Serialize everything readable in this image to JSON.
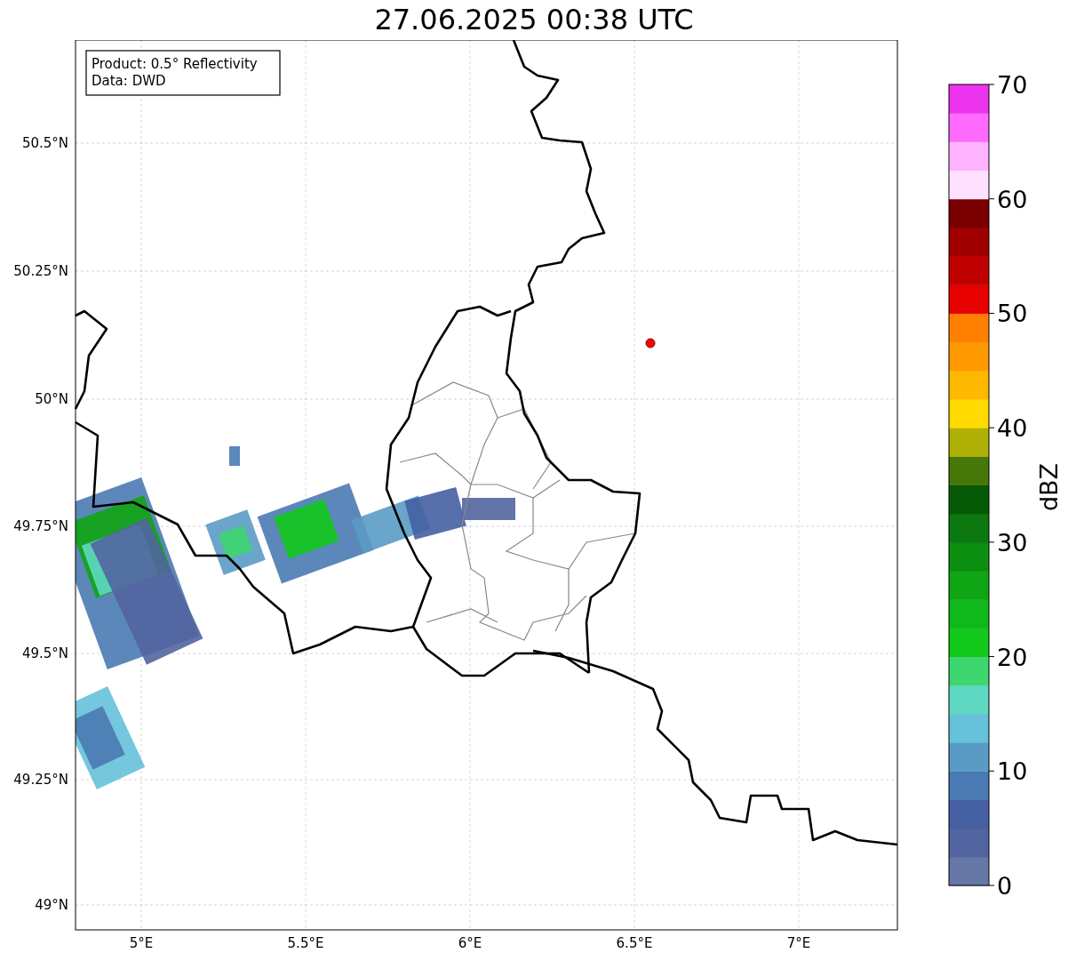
{
  "title": "27.06.2025 00:38 UTC",
  "info_box": [
    "Product: 0.5° Reflectivity",
    "Data: DWD"
  ],
  "map": {
    "lat_ticks": [
      "50.5°N",
      "50.25°N",
      "50°N",
      "49.75°N",
      "49.5°N",
      "49.25°N",
      "49°N"
    ],
    "lon_ticks": [
      "5°E",
      "5.5°E",
      "6°E",
      "6.5°E",
      "7°E"
    ]
  },
  "colorbar": {
    "label": "dBZ",
    "ticks": [
      "70",
      "60",
      "50",
      "40",
      "30",
      "20",
      "10",
      "0"
    ],
    "bands": [
      {
        "color": "#6677a5"
      },
      {
        "color": "#5265a0"
      },
      {
        "color": "#4560a3"
      },
      {
        "color": "#4a7ab3"
      },
      {
        "color": "#5a9bc5"
      },
      {
        "color": "#66c1da"
      },
      {
        "color": "#5fd8c2"
      },
      {
        "color": "#3ed66e"
      },
      {
        "color": "#12c91c"
      },
      {
        "color": "#10b81b"
      },
      {
        "color": "#0fa514"
      },
      {
        "color": "#0c8e11"
      },
      {
        "color": "#0b7810"
      },
      {
        "color": "#065a06"
      },
      {
        "color": "#467708"
      },
      {
        "color": "#afb005"
      },
      {
        "color": "#ffd900"
      },
      {
        "color": "#ffb800"
      },
      {
        "color": "#ff9900"
      },
      {
        "color": "#ff7f00"
      },
      {
        "color": "#e60000"
      },
      {
        "color": "#c00000"
      },
      {
        "color": "#a00000"
      },
      {
        "color": "#7a0000"
      },
      {
        "color": "#ffe0ff"
      },
      {
        "color": "#ffb3ff"
      },
      {
        "color": "#ff6bff"
      },
      {
        "color": "#ee33ee"
      }
    ]
  }
}
